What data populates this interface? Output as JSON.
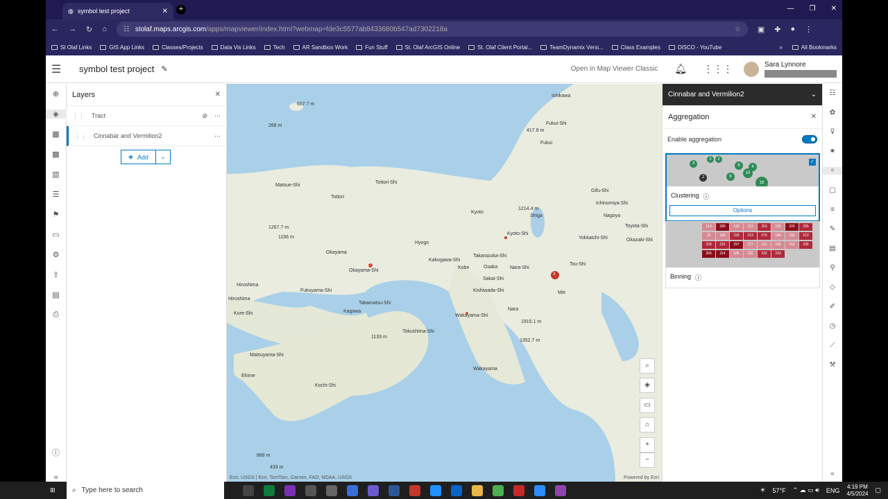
{
  "browser": {
    "tab_title": "symbol test project",
    "url_host": "stolaf.maps.arcgis.com",
    "url_path": "/apps/mapviewer/index.html?webmap=fde3c5577ab8433680b547ad7302218a",
    "bookmarks": [
      "St Olaf Links",
      "GIS App Links",
      "Classes/Projects",
      "Data Vis Links",
      "Tech",
      "AR Sandbox Work",
      "Fun Stuff",
      "St. Olaf ArcGIS Online",
      "St. Olaf Client Portal...",
      "TeamDynamix Versi...",
      "Class Examples",
      "DiSCO - YouTube"
    ],
    "all_bookmarks": "All Bookmarks"
  },
  "app": {
    "title": "symbol test project",
    "open_classic": "Open in Map Viewer Classic",
    "user_name": "Sara Lynnore"
  },
  "layers": {
    "title": "Layers",
    "items": [
      {
        "name": "Tract"
      },
      {
        "name": "Cinnabar and Vermilion2"
      }
    ],
    "add_label": "Add"
  },
  "map": {
    "labels": [
      {
        "t": "Ishikawa",
        "c": "l1"
      },
      {
        "t": "Fukui-Shi",
        "c": "l2"
      },
      {
        "t": "Fukui",
        "c": "l3"
      },
      {
        "t": "Matsue-Shi",
        "c": "l4"
      },
      {
        "t": "Tottori-Shi",
        "c": "l5"
      },
      {
        "t": "Tottori",
        "c": "l6"
      },
      {
        "t": "Kyoto",
        "c": "l7"
      },
      {
        "t": "Shiga",
        "c": "l8"
      },
      {
        "t": "Gifu-Shi",
        "c": "l9"
      },
      {
        "t": "Ichinomiya-Shi",
        "c": "l10"
      },
      {
        "t": "Nagoya",
        "c": "l11"
      },
      {
        "t": "Toyota-Shi",
        "c": "l12"
      },
      {
        "t": "Okazaki-Shi",
        "c": "l13"
      },
      {
        "t": "Yokkaichi-Shi",
        "c": "l14"
      },
      {
        "t": "Kyoto-Shi",
        "c": "l15"
      },
      {
        "t": "Hyogo",
        "c": "l16"
      },
      {
        "t": "Okayama",
        "c": "l17"
      },
      {
        "t": "Takarazuka-Shi",
        "c": "l18"
      },
      {
        "t": "Kakogawa-Shi",
        "c": "l19"
      },
      {
        "t": "Kobe",
        "c": "l20"
      },
      {
        "t": "Osaka",
        "c": "l21"
      },
      {
        "t": "Nara-Shi",
        "c": "l22"
      },
      {
        "t": "Tsu-Shi",
        "c": "l23"
      },
      {
        "t": "Okayama-Shi",
        "c": "l24"
      },
      {
        "t": "Sakai-Shi",
        "c": "l25"
      },
      {
        "t": "Hiroshima",
        "c": "l26"
      },
      {
        "t": "Fukuyama-Shi",
        "c": "l27"
      },
      {
        "t": "Kishiwada-Shi",
        "c": "l28"
      },
      {
        "t": "Mie",
        "c": "l29"
      },
      {
        "t": "Hiroshima",
        "c": "l30"
      },
      {
        "t": "Takamatsu-Shi",
        "c": "l31"
      },
      {
        "t": "Nara",
        "c": "l32"
      },
      {
        "t": "Kure-Shi",
        "c": "l33"
      },
      {
        "t": "Kagawa",
        "c": "l34"
      },
      {
        "t": "Wakayama-Shi",
        "c": "l35"
      },
      {
        "t": "Tokushima-Shi",
        "c": "l36"
      },
      {
        "t": "Matsuyama-Shi",
        "c": "l37"
      },
      {
        "t": "Ehime",
        "c": "l38"
      },
      {
        "t": "Kochi-Shi",
        "c": "l39"
      },
      {
        "t": "Wakayama",
        "c": "l40"
      },
      {
        "t": "607.7 m",
        "c": "l41"
      },
      {
        "t": "268 m",
        "c": "l42"
      },
      {
        "t": "417.8 m",
        "c": "l43"
      },
      {
        "t": "1214.4 m",
        "c": "l44"
      },
      {
        "t": "1267.7 m",
        "c": "l45"
      },
      {
        "t": "1156 m",
        "c": "l46"
      },
      {
        "t": "1915.1 m",
        "c": "l47"
      },
      {
        "t": "1133 m",
        "c": "l48"
      },
      {
        "t": "1352.7 m",
        "c": "l49"
      },
      {
        "t": "868 m",
        "c": "l50"
      },
      {
        "t": "433 m",
        "c": "l51"
      }
    ],
    "cluster_count": "3",
    "attribution": "Esri, USGS | Esri, TomTom, Garmin, FAO, NOAA, USGS",
    "powered": "Powered by Esri"
  },
  "right_panel": {
    "layer_name": "Cinnabar and Vermilion2",
    "aggregation_title": "Aggregation",
    "enable_label": "Enable aggregation",
    "enabled": true,
    "clustering": {
      "label": "Clustering",
      "options": "Options",
      "bubbles": [
        "2",
        "2",
        "3",
        "6",
        "4",
        "10",
        "2",
        "6",
        "16"
      ]
    },
    "binning": {
      "label": "Binning",
      "cells": [
        "113",
        "285",
        "132",
        "123",
        "253",
        "155",
        "320",
        "255",
        "15",
        "145",
        "239",
        "213",
        "270",
        "184",
        "192",
        "213",
        "239",
        "231",
        "297",
        "177",
        "131",
        "145",
        "152",
        "236",
        "359",
        "314",
        "106",
        "192",
        "232",
        "233"
      ]
    }
  },
  "taskbar": {
    "search_placeholder": "Type here to search",
    "temp": "57°F",
    "lang": "ENG",
    "time": "4:19 PM",
    "date": "4/5/2024"
  }
}
